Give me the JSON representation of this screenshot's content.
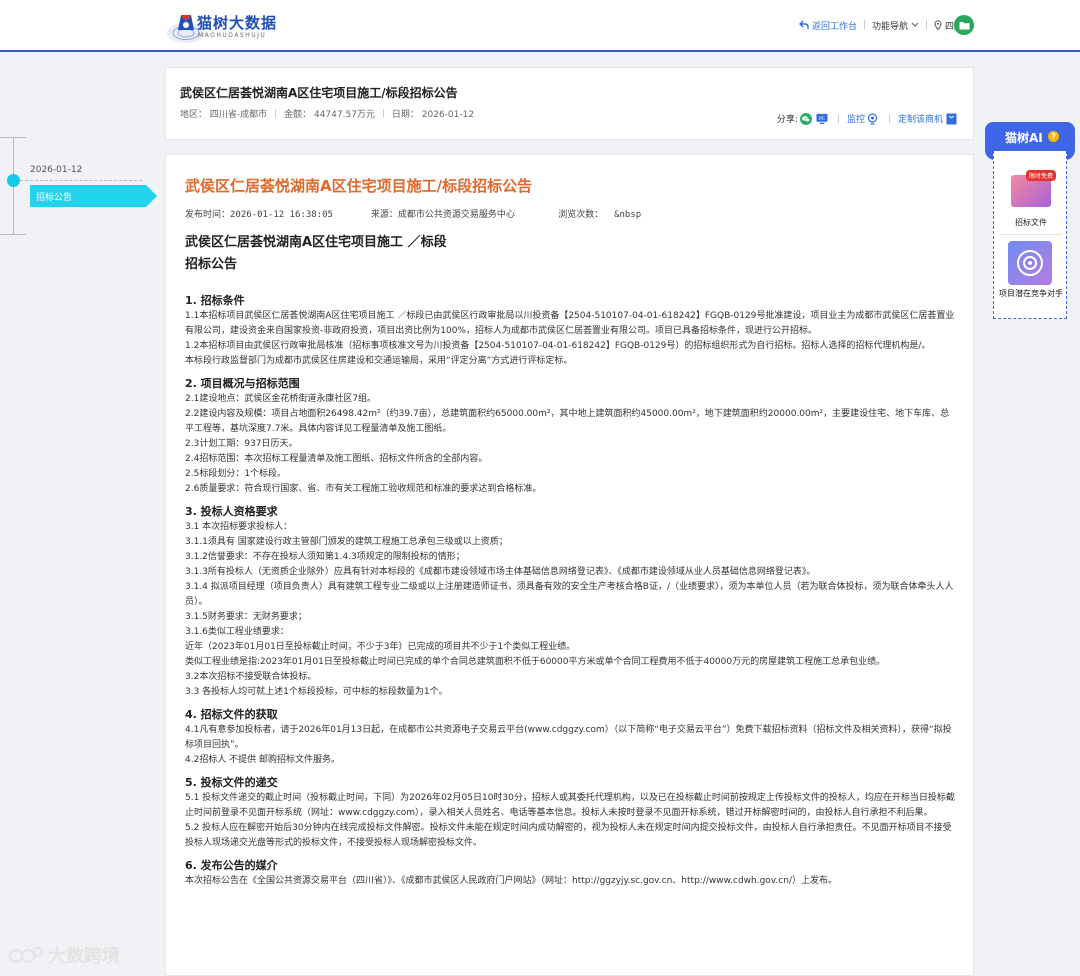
{
  "header": {
    "brand": "猫树大数据",
    "brand_sub": "MAOHUDASHUJU",
    "nav_back": "返回工作台",
    "nav_menu": "功能导航",
    "nav_region": "四川"
  },
  "timeline": {
    "date": "2026-01-12",
    "tag": "招标公告"
  },
  "info_card": {
    "title": "武侯区仁居荟悦湖南A区住宅项目施工/标段招标公告",
    "region": "地区： 四川省-成都市",
    "amount": "金额： 44747.57万元",
    "date": "日期： 2026-01-12",
    "share_label": "分享:",
    "monitor": "监控",
    "subscribe": "定制该商机"
  },
  "notice": {
    "title": "武侯区仁居荟悦湖南A区住宅项目施工/标段招标公告",
    "meta": "发布时间：2026-01-12 16:38:05       来源：成都市公共资源交易服务中心        浏览次数：  &nbsp",
    "heading1": "武侯区仁居荟悦湖南A区住宅项目施工 ／标段",
    "heading2": "招标公告",
    "sections": [
      {
        "title": "1. 招标条件",
        "lines": [
          "1.1本招标项目武侯区仁居荟悦湖南A区住宅项目施工 ／标段已由武侯区行政审批局以川投资备【2504-510107-04-01-618242】FGQB-0129号批准建设，项目业主为成都市武侯区仁居荟置业有限公司，建设资金来自国家投资-非政府投资，项目出资比例为100%，招标人为成都市武侯区仁居荟置业有限公司。项目已具备招标条件，现进行公开招标。",
          "1.2本招标项目由武侯区行政审批局核准（招标事项核准文号为川投资备【2504-510107-04-01-618242】FGQB-0129号）的招标组织形式为自行招标。招标人选择的招标代理机构是/。",
          "本标段行政监督部门为成都市武侯区住房建设和交通运输局，采用“评定分离”方式进行评标定标。"
        ]
      },
      {
        "title": "2. 项目概况与招标范围",
        "lines": [
          "2.1建设地点：武侯区金花桥街道永康社区7组。",
          "2.2建设内容及规模：项目占地面积26498.42m²（约39.7亩），总建筑面积约65000.00m²，其中地上建筑面积约45000.00m²，地下建筑面积约20000.00m²，主要建设住宅、地下车库、总平工程等，基坑深度7.7米。具体内容详见工程量清单及施工图纸。",
          "2.3计划工期：937日历天。",
          "2.4招标范围：本次招标工程量清单及施工图纸、招标文件所含的全部内容。",
          "2.5标段划分：1个标段。",
          "2.6质量要求：符合现行国家、省、市有关工程施工验收规范和标准的要求达到合格标准。"
        ]
      },
      {
        "title": "3. 投标人资格要求",
        "lines": [
          "3.1 本次招标要求投标人：",
          "3.1.1须具有 国家建设行政主管部门颁发的建筑工程施工总承包三级或以上资质；",
          "3.1.2信誉要求：不存在投标人须知第1.4.3项规定的限制投标的情形；",
          "3.1.3所有投标人（无资质企业除外）应具有针对本标段的《成都市建设领域市场主体基础信息网络登记表》、《成都市建设领域从业人员基础信息网络登记表》。",
          "3.1.4 拟派项目经理（项目负责人）具有建筑工程专业二级或以上注册建造师证书，须具备有效的安全生产考核合格B证，/（业绩要求），须为本单位人员（若为联合体投标，须为联合体牵头人人员）。",
          "3.1.5财务要求：无财务要求；",
          "3.1.6类似工程业绩要求：",
          "近年（2023年01月01日至投标截止时间，不少于3年）已完成的项目共不少于1个类似工程业绩。",
          "类似工程业绩是指:2023年01月01日至投标截止时间已完成的单个合同总建筑面积不低于60000平方米或单个合同工程费用不低于40000万元的房屋建筑工程施工总承包业绩。",
          "3.2本次招标不接受联合体投标。",
          "3.3 各投标人均可就上述1个标段投标，可中标的标段数量为1个。"
        ]
      },
      {
        "title": "4. 招标文件的获取",
        "lines": [
          "4.1凡有意参加投标者，请于2026年01月13日起，在成都市公共资源电子交易云平台(www.cdggzy.com）（以下简称“电子交易云平台”）免费下载招标资料（招标文件及相关资料），获得“拟投标项目回执”。",
          "4.2招标人 不提供  邮购招标文件服务。"
        ]
      },
      {
        "title": "5. 投标文件的递交",
        "lines": [
          "5.1 投标文件递交的截止时间（投标截止时间，下同）为2026年02月05日10时30分，招标人或其委托代理机构，以及已在投标截止时间前按规定上传投标文件的投标人，均应在开标当日投标截止时间前登录不见面开标系统（网址：www.cdggzy.com），录入相关人员姓名、电话等基本信息。投标人未按时登录不见面开标系统，错过开标解密时间的，由投标人自行承担不利后果。",
          "5.2 投标人应在解密开始后30分钟内在线完成投标文件解密。投标文件未能在规定时间内成功解密的，视为投标人未在规定时间内提交投标文件，由投标人自行承担责任。不见面开标项目不接受投标人现场递交光盘等形式的投标文件，不接受投标人现场解密投标文件。"
        ]
      },
      {
        "title": "6. 发布公告的媒介",
        "lines": [
          "本次招标公告在《全国公共资源交易平台（四川省）》、《成都市武侯区人民政府门户网站》（网址：http://ggzyjy.sc.gov.cn、http://www.cdwh.gov.cn/）上发布。"
        ]
      }
    ]
  },
  "ai_panel": {
    "title": "猫树AI",
    "badge": "限时免费",
    "item1": "招标文件",
    "item2": "项目潜在竞争对手"
  },
  "watermark": "大数跨境",
  "colors": {
    "brand_blue": "#1f4fb8",
    "accent_orange": "#e0692b",
    "timeline_cyan": "#22d3ee"
  }
}
